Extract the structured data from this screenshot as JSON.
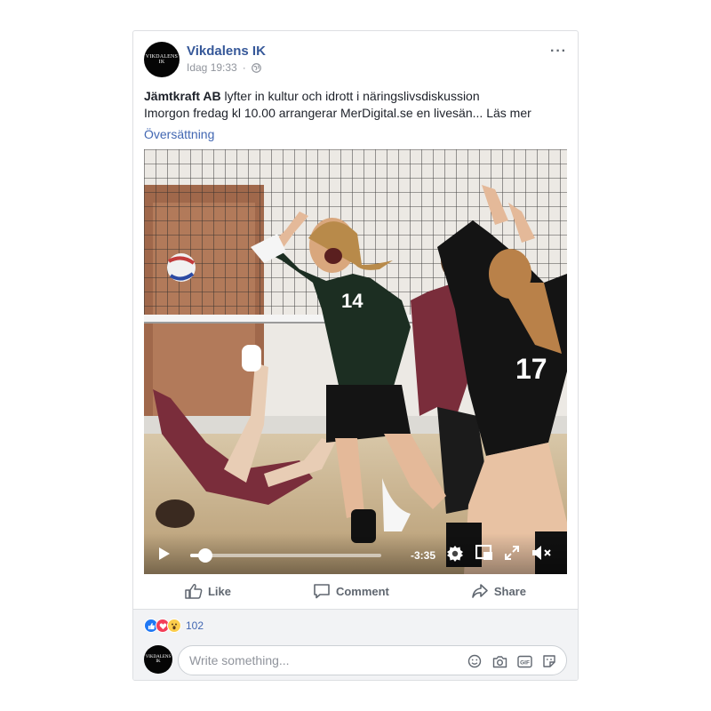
{
  "post": {
    "page_name": "Vikdalens IK",
    "avatar_text": "VIKDALENS IK",
    "timestamp": "Idag 19:33",
    "separator": "·",
    "more_label": "···",
    "bold_text": "Jämtkraft AB",
    "headline_rest": " lyfter in kultur och idrott i näringslivsdiskussion",
    "body_line": "Imorgon fredag kl 10.00 arrangerar MerDigital.se en livesän...",
    "read_more": "Läs mer",
    "translation_link": "Översättning"
  },
  "video": {
    "time_remaining": "-3:35",
    "progress": 0.08,
    "jersey_left": "14",
    "jersey_right": "17"
  },
  "actions": {
    "like": "Like",
    "comment": "Comment",
    "share": "Share"
  },
  "reactions": {
    "count": "102",
    "types": [
      "like",
      "love",
      "wow"
    ]
  },
  "comment": {
    "placeholder": "Write something...",
    "avatar_text": "VIKDALENS IK"
  },
  "colors": {
    "link_blue": "#365899",
    "accent_blue": "#4267b2",
    "muted_gray": "#90949c",
    "like_blue": "#2078f4",
    "love_red": "#f33e58",
    "wow_yellow": "#fbcd4c"
  }
}
